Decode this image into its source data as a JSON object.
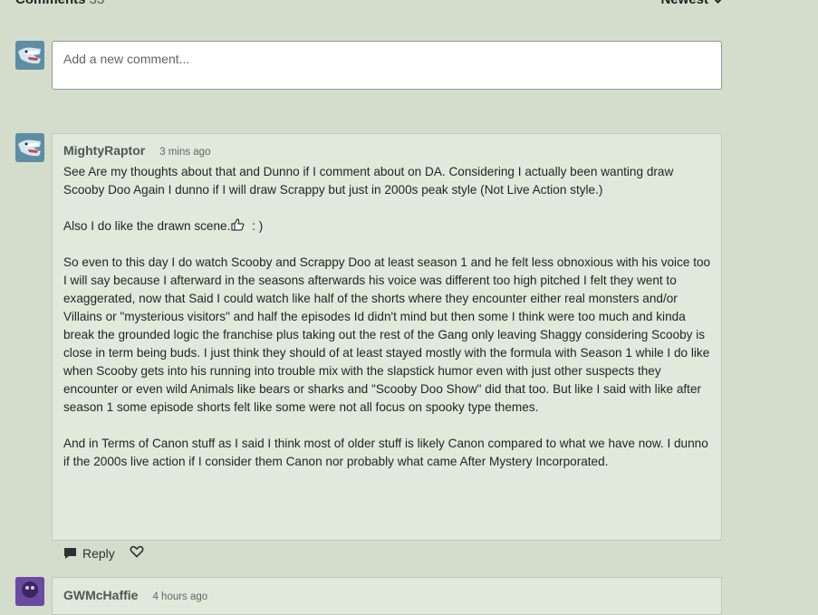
{
  "header": {
    "title": "Comments",
    "count": "33",
    "sort_label": "Newest"
  },
  "new_comment": {
    "placeholder": "Add a new comment..."
  },
  "comments": [
    {
      "username": "MightyRaptor",
      "time": "3 mins ago",
      "paragraphs": [
        "See Are my thoughts about that and Dunno if I comment about on DA. Considering I actually been wanting draw Scooby Doo Again I dunno if I will draw Scrappy but just in 2000s peak style (Not Live Action style.)",
        "Also I do like the drawn scene.",
        ":  )",
        "So even to this day I do watch Scooby and Scrappy Doo at least season 1 and he felt less obnoxious with his voice too I will say because I afterward in the seasons afterwards his voice was different too high pitched I felt they went to exaggerated, now that Said I could watch like half of the shorts where they encounter either real monsters and/or Villains or \"mysterious visitors\" and half the episodes Id didn't mind but then some I think were too much and kinda break the grounded logic the franchise plus taking out the rest of the Gang only leaving Shaggy considering Scooby is close in term being buds. I just think they should of at least stayed mostly with the formula with Season 1 while I do like when Scooby gets into his running into trouble mix with the slapstick humor even with just other suspects they encounter or even wild Animals like bears or sharks and \"Scooby Doo Show\" did that too. But like I said with like after season 1 some episode shorts felt like some were not all focus on spooky type themes.",
        "And in Terms of Canon stuff as I said I think most of older stuff is likely Canon compared to what we have now. I dunno if the 2000s live action if I consider them Canon nor probably what came After Mystery Incorporated."
      ],
      "reply_label": "Reply"
    },
    {
      "username": "GWMcHaffie",
      "time": "4 hours ago"
    }
  ],
  "icons": {
    "reply": "speech-bubble-icon",
    "like": "heart-icon",
    "sort": "chevron-down-icon",
    "emoji": "thumbs-up-emoji-icon"
  }
}
